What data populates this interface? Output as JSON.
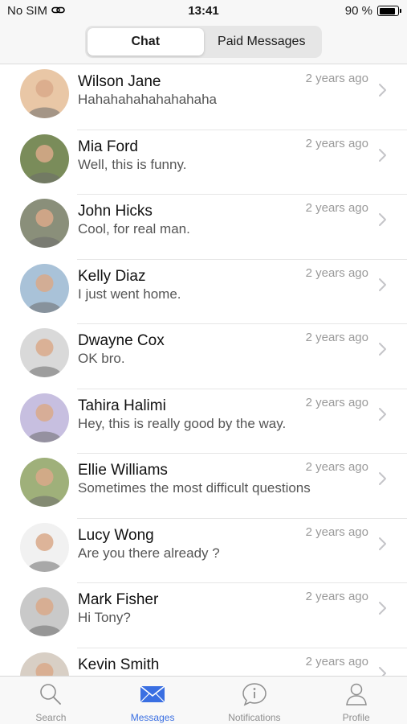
{
  "status_bar": {
    "carrier": "No SIM",
    "time": "13:41",
    "battery_text": "90 %",
    "battery_level": 0.9
  },
  "segmented": {
    "tabs": [
      {
        "label": "Chat",
        "active": true
      },
      {
        "label": "Paid Messages",
        "active": false
      }
    ]
  },
  "chats": [
    {
      "name": "Wilson Jane",
      "message": "Hahahahahahahahaha",
      "time": "2 years ago",
      "avatar_bg": "#e9c7a6"
    },
    {
      "name": "Mia Ford",
      "message": "Well, this is funny.",
      "time": "2 years ago",
      "avatar_bg": "#7a8c5a"
    },
    {
      "name": "John Hicks",
      "message": "Cool, for real man.",
      "time": "2 years ago",
      "avatar_bg": "#8a8f7a"
    },
    {
      "name": "Kelly Diaz",
      "message": "I just went home.",
      "time": "2 years ago",
      "avatar_bg": "#a9c2d8"
    },
    {
      "name": "Dwayne Cox",
      "message": "OK bro.",
      "time": "2 years ago",
      "avatar_bg": "#d9d9d9"
    },
    {
      "name": "Tahira Halimi",
      "message": "Hey, this is really good by the way.",
      "time": "2 years ago",
      "avatar_bg": "#c7bfe0"
    },
    {
      "name": "Ellie Williams",
      "message": "Sometimes the most difficult questions",
      "time": "2 years ago",
      "avatar_bg": "#9fb07a"
    },
    {
      "name": "Lucy Wong",
      "message": "Are you there already ?",
      "time": "2 years ago",
      "avatar_bg": "#f1f1f1"
    },
    {
      "name": "Mark Fisher",
      "message": "Hi Tony?",
      "time": "2 years ago",
      "avatar_bg": "#c9c9c9"
    },
    {
      "name": "Kevin Smith",
      "message": "",
      "time": "2 years ago",
      "avatar_bg": "#d8cfc5"
    }
  ],
  "tab_bar": {
    "items": [
      {
        "label": "Search",
        "icon": "search-icon",
        "active": false
      },
      {
        "label": "Messages",
        "icon": "envelope-icon",
        "active": true
      },
      {
        "label": "Notifications",
        "icon": "info-icon",
        "active": false
      },
      {
        "label": "Profile",
        "icon": "person-icon",
        "active": false
      }
    ]
  },
  "colors": {
    "accent": "#3a6fe2",
    "inactive": "#8e8e8e",
    "timestamp": "#9a9a9a"
  }
}
